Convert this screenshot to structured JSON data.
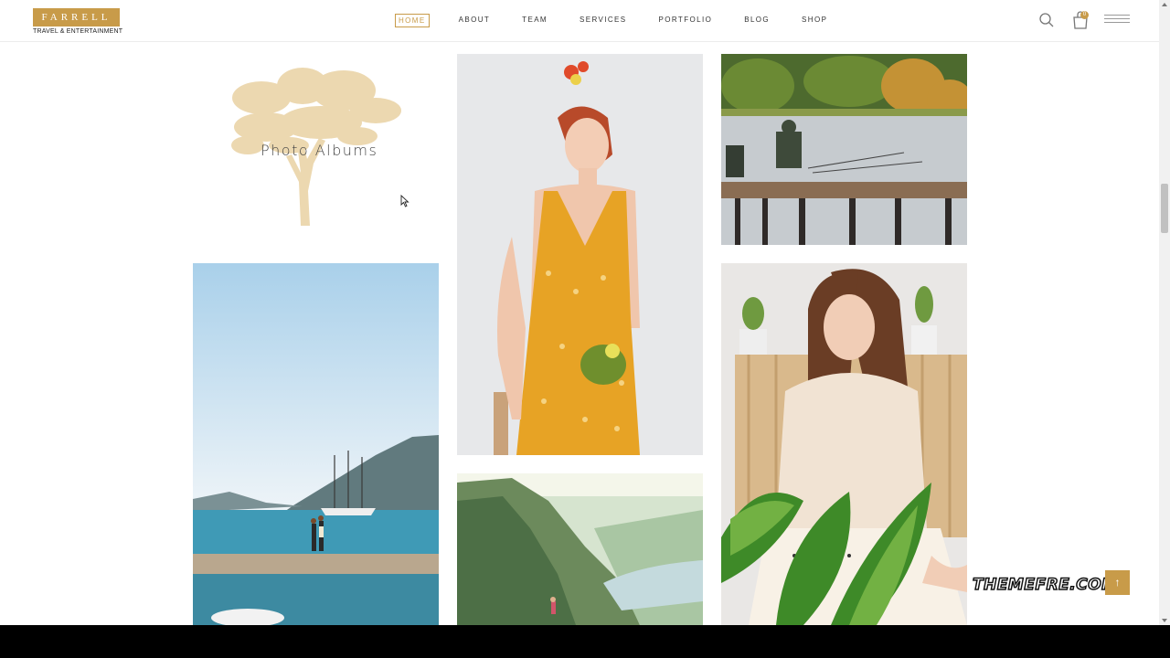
{
  "brand": {
    "name": "FARRELL",
    "tagline": "TRAVEL & ENTERTAINMENT",
    "accent": "#c89b49"
  },
  "nav": {
    "items": [
      {
        "label": "HOME",
        "active": true
      },
      {
        "label": "ABOUT"
      },
      {
        "label": "TEAM"
      },
      {
        "label": "SERVICES"
      },
      {
        "label": "PORTFOLIO"
      },
      {
        "label": "BLOG"
      },
      {
        "label": "SHOP"
      }
    ]
  },
  "header": {
    "cart_count": "0",
    "icons": [
      "search-icon",
      "cart-icon",
      "menu-icon"
    ]
  },
  "album": {
    "title": "Photo Albums",
    "icon": "tree-icon"
  },
  "gallery": {
    "photos": [
      "woman-yellow-dress",
      "lake-fishing",
      "sea-couple-pier",
      "fjord-cliff",
      "girl-with-plant"
    ]
  },
  "watermark": {
    "text": "THEMEFRE.COM"
  },
  "back_to_top": {
    "icon": "arrow-up-icon",
    "glyph": "↑"
  }
}
